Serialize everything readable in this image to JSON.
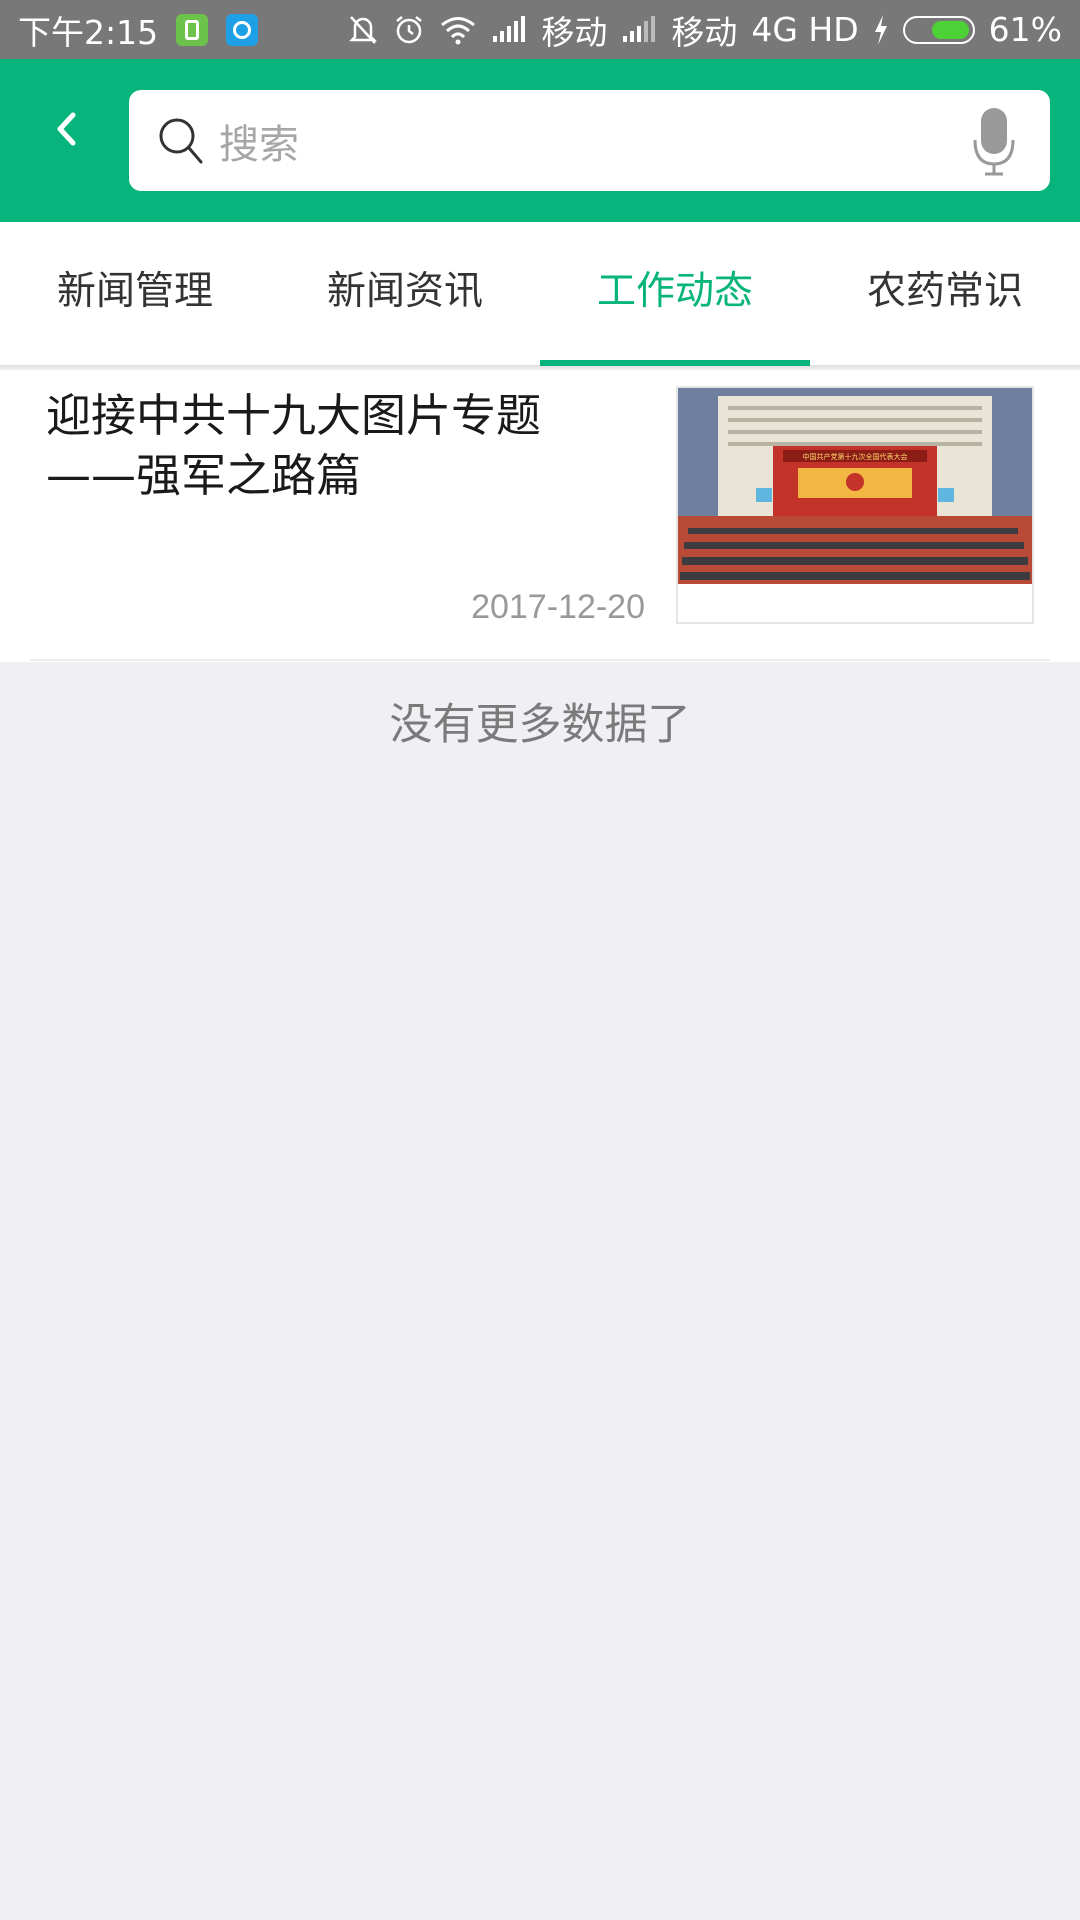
{
  "status_bar": {
    "time": "下午2:15",
    "carrier1": "移动",
    "carrier2": "移动",
    "network": "4G HD",
    "battery": "61%",
    "battery_level": 0.61
  },
  "header": {
    "back_icon": "chevron-left-icon",
    "search": {
      "placeholder": "搜索",
      "search_icon": "search-icon",
      "mic_icon": "microphone-icon"
    }
  },
  "tabs": [
    {
      "label": "新闻管理",
      "active": false
    },
    {
      "label": "新闻资讯",
      "active": false
    },
    {
      "label": "工作动态",
      "active": true
    },
    {
      "label": "农药常识",
      "active": false
    }
  ],
  "news": [
    {
      "title": "迎接中共十九大图片专题——强军之路篇",
      "date": "2017-12-20",
      "image_banner": "中国共产党第十九次全国代表大会"
    }
  ],
  "footer_text": "没有更多数据了",
  "colors": {
    "brand_green": "#07b57c",
    "status_bar": "#787878",
    "background": "#efeff4"
  }
}
